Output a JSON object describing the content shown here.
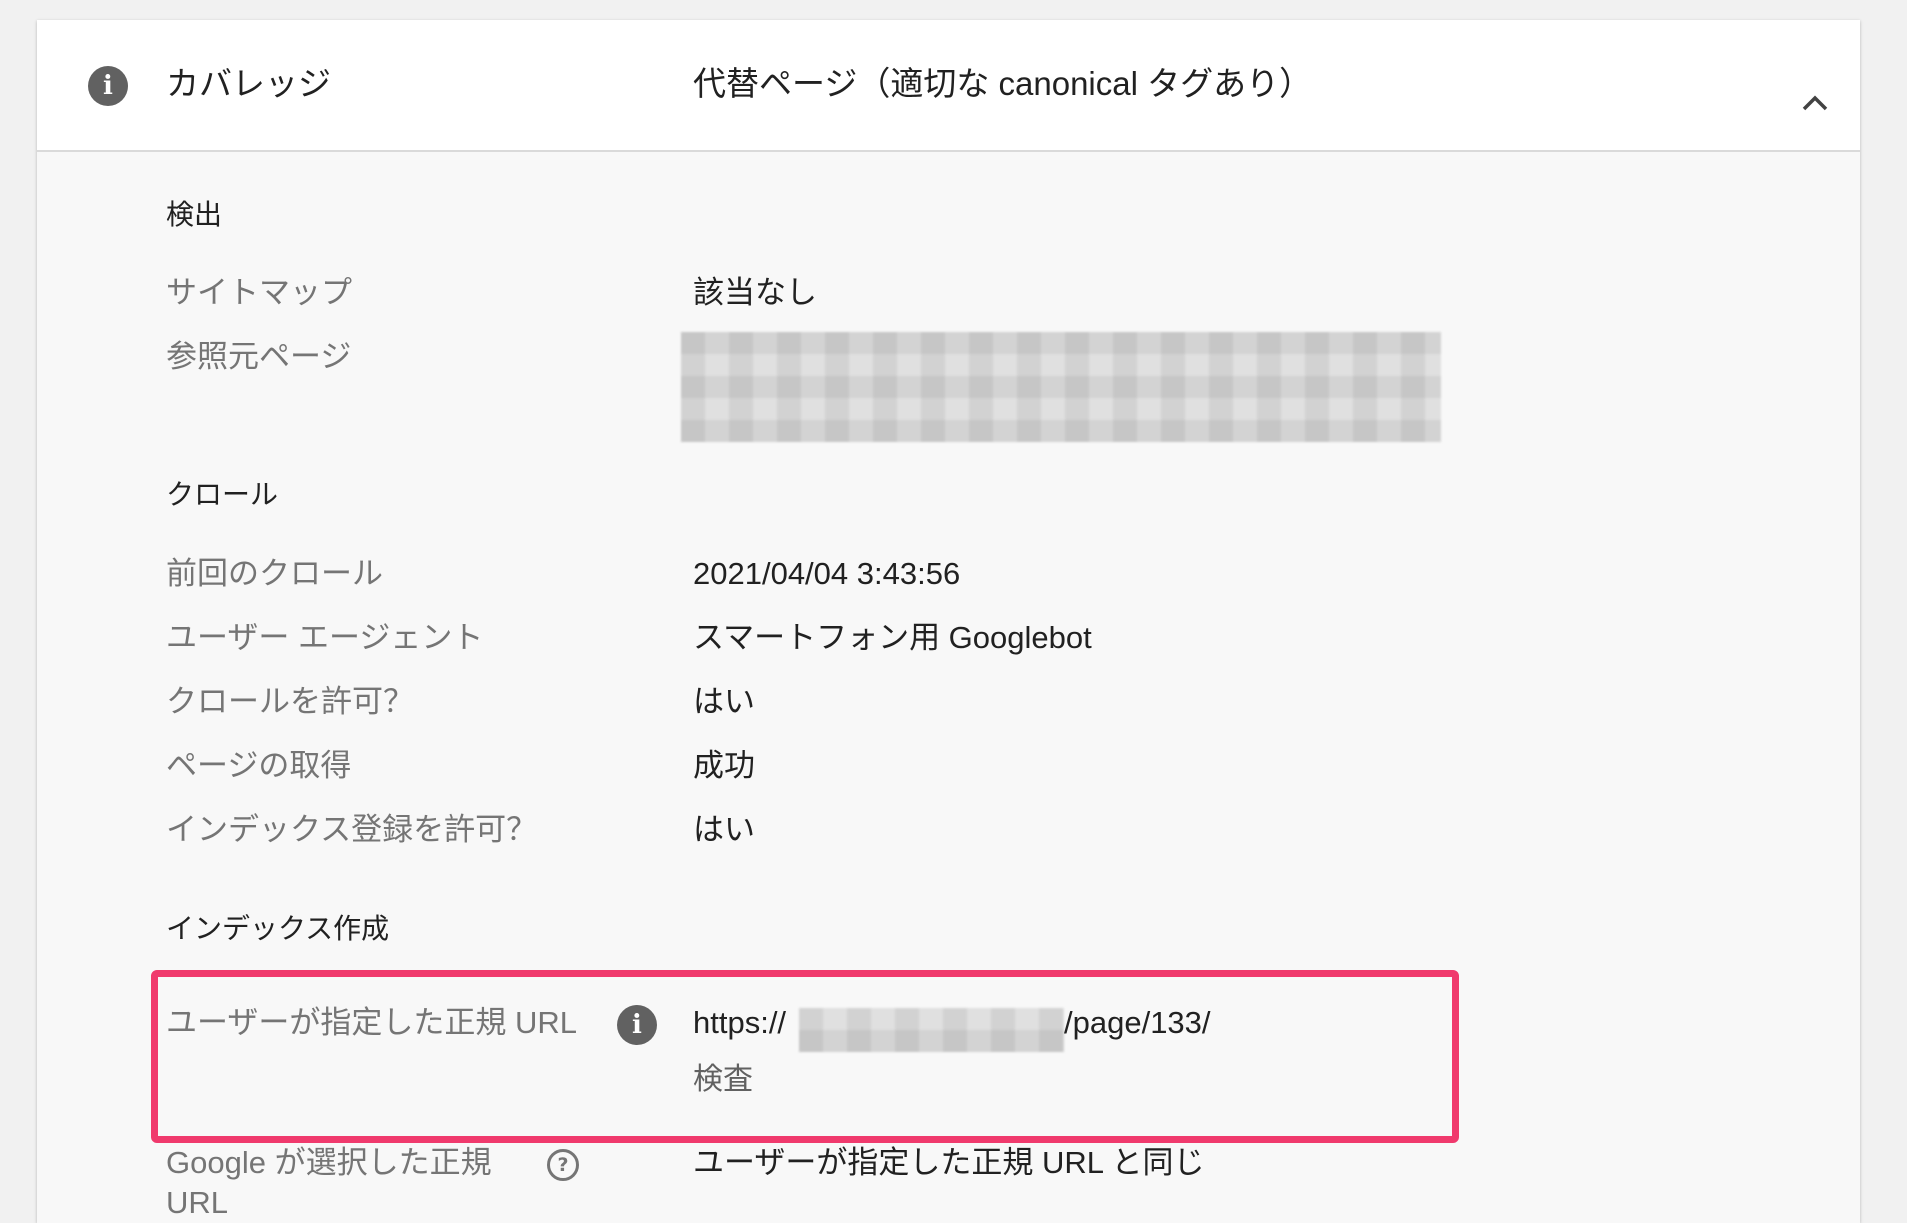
{
  "header": {
    "label": "カバレッジ",
    "value": "代替ページ（適切な canonical タグあり）",
    "info_glyph": "i"
  },
  "discovery": {
    "title": "検出",
    "rows": [
      {
        "label": "サイトマップ",
        "value": "該当なし"
      },
      {
        "label": "参照元ページ",
        "value": ""
      }
    ]
  },
  "crawl": {
    "title": "クロール",
    "rows": [
      {
        "label": "前回のクロール",
        "value": "2021/04/04 3:43:56"
      },
      {
        "label": "ユーザー エージェント",
        "value": "スマートフォン用 Googlebot"
      },
      {
        "label": "クロールを許可？",
        "value": "はい"
      },
      {
        "label": "ページの取得",
        "value": "成功"
      },
      {
        "label": "インデックス登録を許可？",
        "value": "はい"
      }
    ]
  },
  "indexing": {
    "title": "インデックス作成",
    "user_canonical": {
      "label": "ユーザーが指定した正規 URL",
      "url_prefix": "https://",
      "url_suffix": "/page/133/",
      "inspect_label": "検査",
      "info_glyph": "i"
    },
    "google_canonical": {
      "label_line1": "Google が選択した正規",
      "label_line2": "URL",
      "value": "ユーザーが指定した正規 URL と同じ",
      "help_glyph": "?"
    }
  },
  "colors": {
    "highlight": "#f03a6d",
    "icon": "#616161"
  },
  "icons": [
    "info-icon",
    "chevron-up-icon",
    "help-icon"
  ]
}
